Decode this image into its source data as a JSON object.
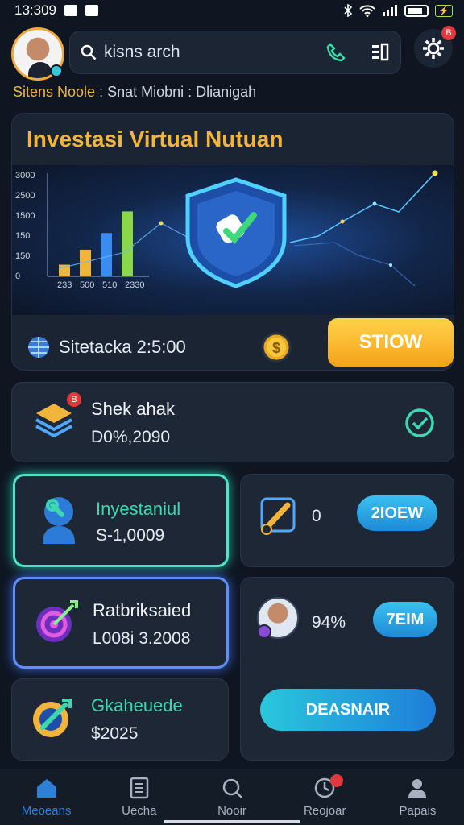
{
  "status_bar": {
    "time": "13:309"
  },
  "header": {
    "search_text": "kisns arch",
    "gear_badge": "B"
  },
  "subline": {
    "highlight": "Sitens Noole",
    "rest": " : Snat Miobni : Dlianigah"
  },
  "hero": {
    "title": "Investasi Virtual Nutuan",
    "y_ticks": [
      "3000",
      "2500",
      "1500",
      "150",
      "150",
      "0"
    ],
    "x_ticks": [
      "233",
      "500",
      "510",
      "2330"
    ],
    "label": "Sitetacka 2:5:00",
    "button": "STIOW"
  },
  "chart_data": {
    "type": "bar",
    "categories": [
      "233",
      "500",
      "510",
      "2330"
    ],
    "values": [
      350,
      800,
      1300,
      1950
    ],
    "ylim": [
      0,
      3000
    ]
  },
  "summary_card": {
    "title": "Shek ahak",
    "value": "D0%,2090",
    "badge": "B"
  },
  "cards": {
    "invest": {
      "title": "Inyestaniul",
      "value": "S-1,0009"
    },
    "count": {
      "value": "0",
      "button": "2IOEW"
    },
    "ratio": {
      "title": "Ratbriksaied",
      "value": "L008i 3.2008"
    },
    "percent": {
      "value": "94%",
      "button": "7EIM"
    },
    "exchange": {
      "title": "Gkaheuede",
      "value": "$2025"
    },
    "action": {
      "button": "DEASNAIR"
    }
  },
  "nav": [
    {
      "label": "Meoeans",
      "icon": "home-icon"
    },
    {
      "label": "Uecha",
      "icon": "document-icon"
    },
    {
      "label": "Nooir",
      "icon": "search-icon"
    },
    {
      "label": "Reojoar",
      "icon": "clock-icon"
    },
    {
      "label": "Papais",
      "icon": "user-icon"
    }
  ],
  "colors": {
    "accent": "#f2b53b",
    "cyan": "#4fe3c8",
    "blue": "#5e8fff",
    "nav_active": "#2f7fd6"
  }
}
